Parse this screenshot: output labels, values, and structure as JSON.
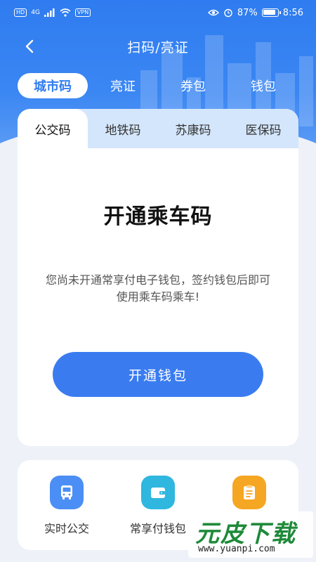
{
  "status_bar": {
    "sim_label": "HD",
    "network_label": "4G",
    "vpn_label": "VPN",
    "battery_percent": "87%",
    "time": "8:56"
  },
  "nav": {
    "title": "扫码/亮证"
  },
  "top_tabs": [
    {
      "label": "城市码",
      "active": true
    },
    {
      "label": "亮证",
      "active": false
    },
    {
      "label": "券包",
      "active": false
    },
    {
      "label": "钱包",
      "active": false
    }
  ],
  "sub_tabs": [
    {
      "label": "公交码",
      "active": true
    },
    {
      "label": "地铁码",
      "active": false
    },
    {
      "label": "苏康码",
      "active": false
    },
    {
      "label": "医保码",
      "active": false
    }
  ],
  "card": {
    "title": "开通乘车码",
    "description": "您尚未开通常享付电子钱包，签约钱包后即可使用乘车码乘车!",
    "button_label": "开通钱包"
  },
  "services": [
    {
      "label": "实时公交",
      "icon": "bus-icon",
      "color": "#4b8ef5"
    },
    {
      "label": "常享付钱包",
      "icon": "wallet-icon",
      "color": "#2fb7e0"
    },
    {
      "label": "",
      "icon": "clipboard-icon",
      "color": "#f5a623"
    }
  ],
  "watermark": {
    "brand": "元皮下载",
    "url": "www.yuanpi.com"
  },
  "colors": {
    "primary": "#2f7cf0",
    "button": "#3a7cf0",
    "subtab_bg": "#d4e6fb",
    "page_bg": "#eef2f8"
  }
}
